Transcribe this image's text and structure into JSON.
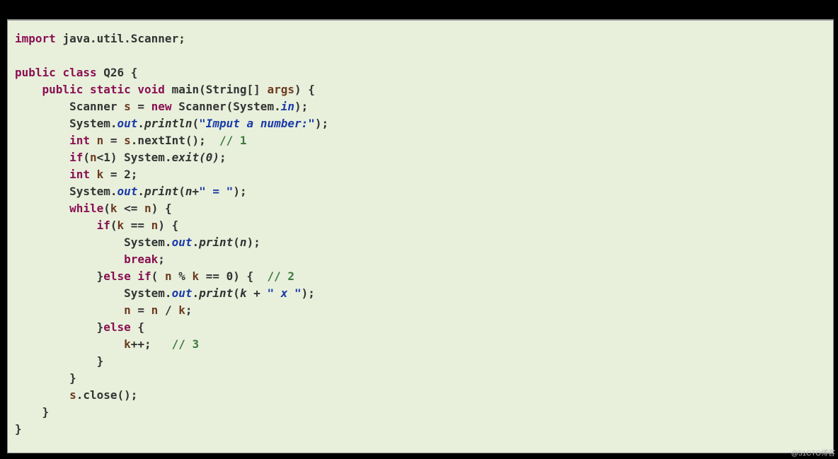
{
  "code": {
    "l1": {
      "kw_import": "import",
      "pkg": "java.util.Scanner",
      "semi": ";"
    },
    "l3": {
      "kw_public": "public",
      "kw_class": "class",
      "cls": "Q26",
      "ob": "{"
    },
    "l4": {
      "kw_public": "public",
      "kw_static": "static",
      "kw_void": "void",
      "main": "main",
      "sig_open": "(String[] ",
      "args": "args",
      "sig_close": ")",
      "ob": "{"
    },
    "l5": {
      "scanner_t": "Scanner ",
      "s": "s",
      "eq": " = ",
      "kw_new": "new",
      "ctor": " Scanner(System.",
      "in": "in",
      "close": ");"
    },
    "l6": {
      "sys": "System.",
      "out": "out",
      "dot": ".",
      "println": "println",
      "open": "(",
      "str": "\"Imput a number:\"",
      "close": ");"
    },
    "l7": {
      "kw_int": "int",
      "sp": " ",
      "n": "n",
      "eq": " = ",
      "s": "s",
      "call": ".nextInt();  ",
      "cmt": "// 1"
    },
    "l8": {
      "kw_if": "if",
      "open": "(",
      "n": "n",
      "lt": "<1) System.",
      "exit": "exit",
      "args": "(0)",
      "semi": ";"
    },
    "l9": {
      "kw_int": "int",
      "sp": " ",
      "k": "k",
      "rest": " = 2;"
    },
    "l10": {
      "sys": "System.",
      "out": "out",
      "dot": ".",
      "print": "print",
      "open": "(",
      "n": "n",
      "plus": "+",
      "str": "\" = \"",
      "close": ");"
    },
    "l11": {
      "kw_while": "while",
      "open": "(",
      "k": "k",
      "le": " <= ",
      "n": "n",
      "close": ") {"
    },
    "l12": {
      "kw_if": "if",
      "open": "(",
      "k": "k",
      "eq": " == ",
      "n": "n",
      "close": ") {"
    },
    "l13": {
      "sys": "System.",
      "out": "out",
      "dot": ".",
      "print": "print",
      "open": "(",
      "n": "n",
      "close": ");"
    },
    "l14": {
      "kw_break": "break",
      "semi": ";"
    },
    "l15": {
      "cb": "}",
      "kw_else": "else",
      "sp": " ",
      "kw_if": "if",
      "open": "( ",
      "n": "n",
      "mod": " % ",
      "k": "k",
      "eq0": " == 0) {  ",
      "cmt": "// 2"
    },
    "l16": {
      "sys": "System.",
      "out": "out",
      "dot": ".",
      "print": "print",
      "open": "(",
      "k": "k",
      "plus": " + ",
      "str": "\" x \"",
      "close": ");"
    },
    "l17": {
      "n1": "n",
      "eq": " = ",
      "n2": "n",
      "div": " / ",
      "k": "k",
      "semi": ";"
    },
    "l18": {
      "cb": "}",
      "kw_else": "else",
      "ob": " {"
    },
    "l19": {
      "k": "k",
      "inc": "++;   ",
      "cmt": "// 3"
    },
    "l20": {
      "cb": "}"
    },
    "l21": {
      "cb": "}"
    },
    "l22": {
      "s": "s",
      "close": ".close();"
    },
    "l23": {
      "cb": "}"
    },
    "l24": {
      "cb": "}"
    }
  },
  "watermark": "@51CTO博客"
}
